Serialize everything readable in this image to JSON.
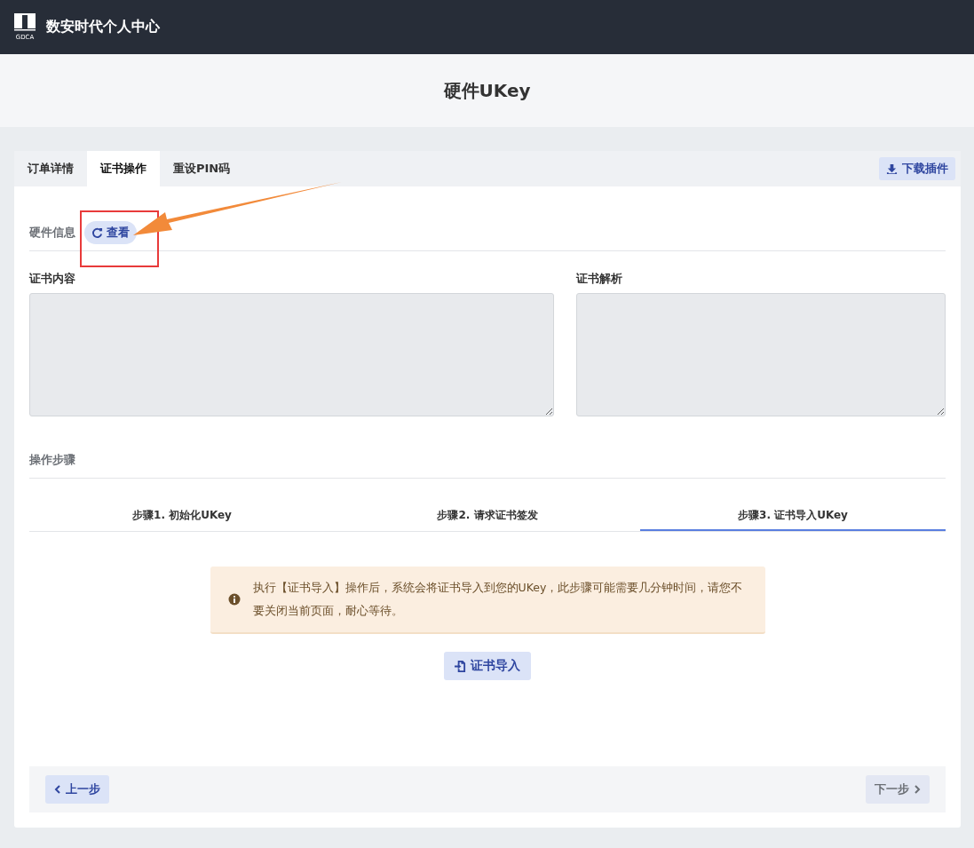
{
  "header": {
    "logo_text": "GDCA",
    "title": "数安时代个人中心"
  },
  "page_title": "硬件UKey",
  "tabs": [
    {
      "label": "订单详情",
      "selected": false
    },
    {
      "label": "证书操作",
      "selected": true
    },
    {
      "label": "重设PIN码",
      "selected": false
    }
  ],
  "download_button": "下载插件",
  "hardware": {
    "label": "硬件信息",
    "button": "查看"
  },
  "fields": [
    {
      "label": "证书内容"
    },
    {
      "label": "证书解析"
    }
  ],
  "steps_title": "操作步骤",
  "steps": [
    {
      "label": "步骤1. 初始化UKey",
      "selected": false
    },
    {
      "label": "步骤2. 请求证书签发",
      "selected": false
    },
    {
      "label": "步骤3. 证书导入UKey",
      "selected": true
    }
  ],
  "alert": "执行【证书导入】操作后，系统会将证书导入到您的UKey，此步骤可能需要几分钟时间，请您不要关闭当前页面，耐心等待。",
  "action_button": "证书导入",
  "nav": [
    {
      "label": "上一步",
      "kind": "prev",
      "disabled": false
    },
    {
      "label": "下一步",
      "kind": "next",
      "disabled": true
    }
  ]
}
